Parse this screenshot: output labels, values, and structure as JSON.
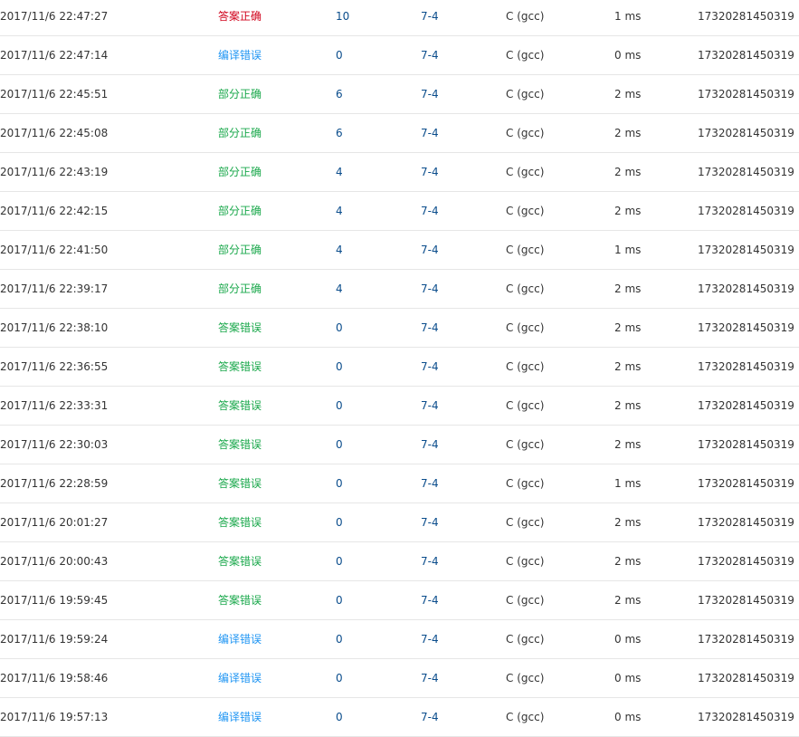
{
  "rows": [
    {
      "submit_time": "2017/11/6 22:47:27",
      "status": "答案正确",
      "status_type": "accepted",
      "score": "10",
      "problem": "7-4",
      "compiler": "C (gcc)",
      "time_used": "1 ms",
      "user": "17320281450319"
    },
    {
      "submit_time": "2017/11/6 22:47:14",
      "status": "编译错误",
      "status_type": "compile",
      "score": "0",
      "problem": "7-4",
      "compiler": "C (gcc)",
      "time_used": "0 ms",
      "user": "17320281450319"
    },
    {
      "submit_time": "2017/11/6 22:45:51",
      "status": "部分正确",
      "status_type": "partial",
      "score": "6",
      "problem": "7-4",
      "compiler": "C (gcc)",
      "time_used": "2 ms",
      "user": "17320281450319"
    },
    {
      "submit_time": "2017/11/6 22:45:08",
      "status": "部分正确",
      "status_type": "partial",
      "score": "6",
      "problem": "7-4",
      "compiler": "C (gcc)",
      "time_used": "2 ms",
      "user": "17320281450319"
    },
    {
      "submit_time": "2017/11/6 22:43:19",
      "status": "部分正确",
      "status_type": "partial",
      "score": "4",
      "problem": "7-4",
      "compiler": "C (gcc)",
      "time_used": "2 ms",
      "user": "17320281450319"
    },
    {
      "submit_time": "2017/11/6 22:42:15",
      "status": "部分正确",
      "status_type": "partial",
      "score": "4",
      "problem": "7-4",
      "compiler": "C (gcc)",
      "time_used": "2 ms",
      "user": "17320281450319"
    },
    {
      "submit_time": "2017/11/6 22:41:50",
      "status": "部分正确",
      "status_type": "partial",
      "score": "4",
      "problem": "7-4",
      "compiler": "C (gcc)",
      "time_used": "1 ms",
      "user": "17320281450319"
    },
    {
      "submit_time": "2017/11/6 22:39:17",
      "status": "部分正确",
      "status_type": "partial",
      "score": "4",
      "problem": "7-4",
      "compiler": "C (gcc)",
      "time_used": "2 ms",
      "user": "17320281450319"
    },
    {
      "submit_time": "2017/11/6 22:38:10",
      "status": "答案错误",
      "status_type": "wrong",
      "score": "0",
      "problem": "7-4",
      "compiler": "C (gcc)",
      "time_used": "2 ms",
      "user": "17320281450319"
    },
    {
      "submit_time": "2017/11/6 22:36:55",
      "status": "答案错误",
      "status_type": "wrong",
      "score": "0",
      "problem": "7-4",
      "compiler": "C (gcc)",
      "time_used": "2 ms",
      "user": "17320281450319"
    },
    {
      "submit_time": "2017/11/6 22:33:31",
      "status": "答案错误",
      "status_type": "wrong",
      "score": "0",
      "problem": "7-4",
      "compiler": "C (gcc)",
      "time_used": "2 ms",
      "user": "17320281450319"
    },
    {
      "submit_time": "2017/11/6 22:30:03",
      "status": "答案错误",
      "status_type": "wrong",
      "score": "0",
      "problem": "7-4",
      "compiler": "C (gcc)",
      "time_used": "2 ms",
      "user": "17320281450319"
    },
    {
      "submit_time": "2017/11/6 22:28:59",
      "status": "答案错误",
      "status_type": "wrong",
      "score": "0",
      "problem": "7-4",
      "compiler": "C (gcc)",
      "time_used": "1 ms",
      "user": "17320281450319"
    },
    {
      "submit_time": "2017/11/6 20:01:27",
      "status": "答案错误",
      "status_type": "wrong",
      "score": "0",
      "problem": "7-4",
      "compiler": "C (gcc)",
      "time_used": "2 ms",
      "user": "17320281450319"
    },
    {
      "submit_time": "2017/11/6 20:00:43",
      "status": "答案错误",
      "status_type": "wrong",
      "score": "0",
      "problem": "7-4",
      "compiler": "C (gcc)",
      "time_used": "2 ms",
      "user": "17320281450319"
    },
    {
      "submit_time": "2017/11/6 19:59:45",
      "status": "答案错误",
      "status_type": "wrong",
      "score": "0",
      "problem": "7-4",
      "compiler": "C (gcc)",
      "time_used": "2 ms",
      "user": "17320281450319"
    },
    {
      "submit_time": "2017/11/6 19:59:24",
      "status": "编译错误",
      "status_type": "compile",
      "score": "0",
      "problem": "7-4",
      "compiler": "C (gcc)",
      "time_used": "0 ms",
      "user": "17320281450319"
    },
    {
      "submit_time": "2017/11/6 19:58:46",
      "status": "编译错误",
      "status_type": "compile",
      "score": "0",
      "problem": "7-4",
      "compiler": "C (gcc)",
      "time_used": "0 ms",
      "user": "17320281450319"
    },
    {
      "submit_time": "2017/11/6 19:57:13",
      "status": "编译错误",
      "status_type": "compile",
      "score": "0",
      "problem": "7-4",
      "compiler": "C (gcc)",
      "time_used": "0 ms",
      "user": "17320281450319"
    }
  ],
  "colors": {
    "accepted": "#d0021b",
    "compile_error": "#2196f3",
    "partial": "#1aa84b",
    "wrong": "#1aa84b",
    "link": "#0b4d8c",
    "text": "#333333",
    "divider": "#e6e6e6"
  }
}
